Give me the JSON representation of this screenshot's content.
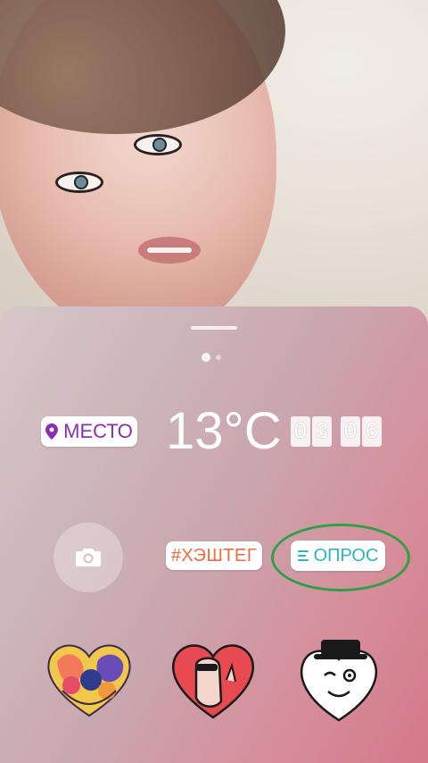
{
  "colors": {
    "location_text": "#8a2fb3",
    "hashtag_text": "#f06a3c",
    "poll_text": "#2bb3c7",
    "highlight_ring": "#2f9f4a",
    "panel_gradient": [
      "#d7c7cb",
      "#d4788a"
    ]
  },
  "stickers_panel": {
    "page_indicator": {
      "current": 1,
      "total": 2
    },
    "location_label": "МЕСТО",
    "temperature_label": "13°C",
    "clock_digits": [
      "0",
      "3",
      "0",
      "6"
    ],
    "camera_icon": "camera-icon",
    "hashtag_label": "#ХЭШТЕГ",
    "poll_label": "ОПРОС",
    "gif_stickers": [
      {
        "name": "heart-hands-sticker"
      },
      {
        "name": "peeking-heart-sticker"
      },
      {
        "name": "winking-heart-hat-sticker"
      }
    ]
  }
}
